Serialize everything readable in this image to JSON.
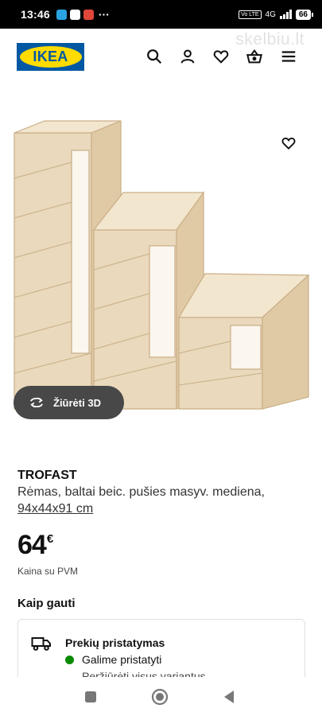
{
  "status_bar": {
    "time": "13:46",
    "dots": "···",
    "volte": "Vo LTE",
    "network": "4G",
    "battery": "66",
    "app_icons": [
      "telegram-icon",
      "google-icon",
      "app-icon",
      "notification-icon"
    ],
    "icon_colors": [
      "#2aa3e0",
      "#ffffff",
      "#e2463a"
    ]
  },
  "header": {
    "logo_text": "IKEA",
    "watermark": "skelbiu.lt",
    "brand_blue": "#0058a3",
    "brand_yellow": "#ffdb00",
    "icons": [
      "search-icon",
      "user-icon",
      "heart-icon",
      "basket-icon",
      "menu-icon"
    ]
  },
  "product": {
    "name": "TROFAST",
    "description": "Rėmas, baltai beic. pušies masyv. mediena,",
    "dimensions": "94x44x91 cm",
    "price": "64",
    "currency": "€",
    "vat_note": "Kaina su PVM",
    "view_3d_label": "Žiūrėti 3D"
  },
  "delivery": {
    "section_title": "Kaip gauti",
    "title": "Prekių pristatymas",
    "status": "Galime pristatyti",
    "link": "Peržiūrėti visus variantus",
    "status_color": "#0a8a00"
  },
  "nav_bar": {
    "icons": [
      "recents-icon",
      "home-icon",
      "back-icon"
    ]
  }
}
